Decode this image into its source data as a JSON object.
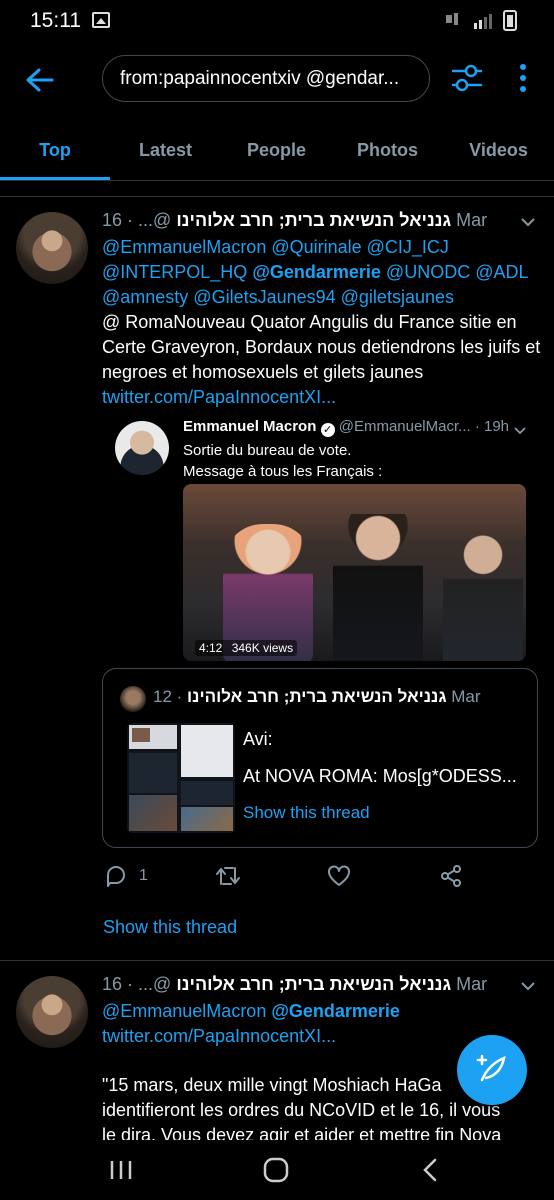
{
  "status": {
    "time": "15:11"
  },
  "search": {
    "query": "from:papainnocentxiv @gendar..."
  },
  "tabs": [
    "Top",
    "Latest",
    "People",
    "Photos",
    "Videos"
  ],
  "tweet1": {
    "display_name": "גנניאל הנשיאת ברית; חרב אלוהינו",
    "handle": "@...",
    "date": "· 16 Mar",
    "line1": "@EmmanuelMacron @Quirinale @CIJ_ICJ",
    "line2a": "@INTERPOL_HQ ",
    "line2b": "@Gendarmerie",
    "line2c": " @UNODC @ADL",
    "line3": "@amnesty @GiletsJaunes94 @giletsjaunes",
    "body": "@ RomaNouveau Quator Angulis du France sitie en Certe Graveyron, Bordaux nous detiendrons les juifs et negroes et homosexuels et gilets jaunes",
    "link": "twitter.com/PapaInnocentXI...",
    "embed": {
      "name": "Emmanuel Macron",
      "handle": "@EmmanuelMacr...",
      "time": "· 19h",
      "line1": "Sortie du bureau de vote.",
      "line2": "Message à tous les Français :",
      "duration": "4:12",
      "views": "346K views"
    },
    "quote": {
      "display_name": "גנניאל הנשיאת ברית; חרב אלוהינו",
      "date": "· 12 Mar",
      "line1": "Avi:",
      "line2": "At NOVA ROMA: Mos[g*ODESS...",
      "show_thread": "Show this thread"
    },
    "reply_count": "1",
    "show_thread": "Show this thread"
  },
  "tweet2": {
    "display_name": "גנניאל הנשיאת ברית; חרב אלוהינו",
    "handle": "@...",
    "date": "· 16 Mar",
    "line1a": "@EmmanuelMacron ",
    "line1b": "@Gendarmerie",
    "link": "twitter.com/PapaInnocentXI...",
    "line2": "\"15 mars, deux mille vingt Moshiach HaGa",
    "line3": "identifieront les ordres du NCoVID et le 16, il vous",
    "line4": "le dira. Vous devez agir et aider et mettre fin Nova"
  },
  "colors": {
    "accent": "#1da1f2",
    "secondary": "#8899a6",
    "background": "#000000"
  }
}
